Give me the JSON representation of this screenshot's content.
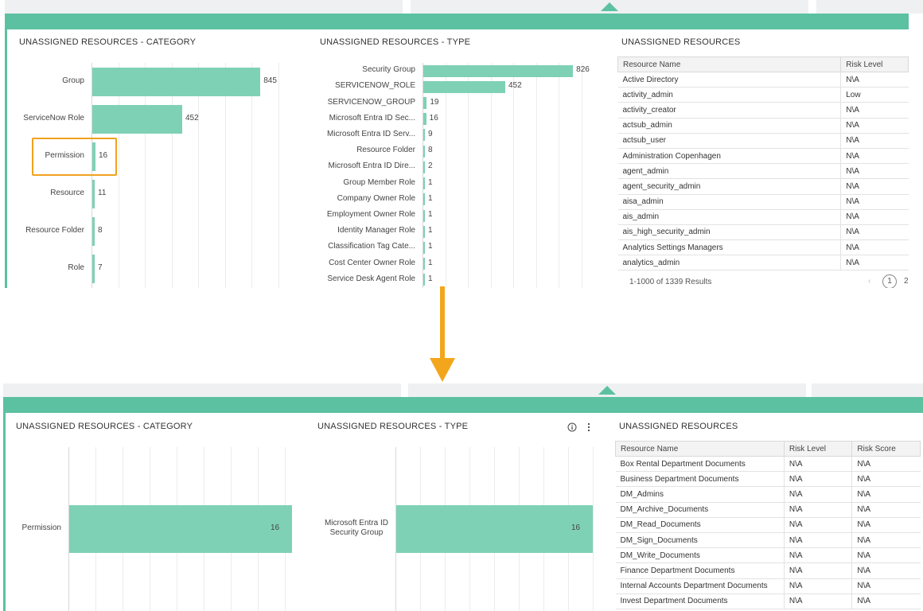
{
  "top": {
    "category_panel": {
      "title": "UNASSIGNED RESOURCES - CATEGORY",
      "chart_data": {
        "type": "bar",
        "orientation": "horizontal",
        "categories": [
          "Group",
          "ServiceNow Role",
          "Permission",
          "Resource",
          "Resource Folder",
          "Role"
        ],
        "values": [
          845,
          452,
          16,
          11,
          8,
          7
        ],
        "highlighted_category": "Permission"
      }
    },
    "type_panel": {
      "title": "UNASSIGNED RESOURCES - TYPE",
      "chart_data": {
        "type": "bar",
        "orientation": "horizontal",
        "categories": [
          "Security Group",
          "SERVICENOW_ROLE",
          "SERVICENOW_GROUP",
          "Microsoft Entra ID Sec...",
          "Microsoft Entra ID Serv...",
          "Resource Folder",
          "Microsoft Entra ID Dire...",
          "Group Member Role",
          "Company Owner Role",
          "Employment Owner Role",
          "Identity Manager Role",
          "Classification Tag Cate...",
          "Cost Center Owner Role",
          "Service Desk Agent Role"
        ],
        "values": [
          826,
          452,
          19,
          16,
          9,
          8,
          2,
          1,
          1,
          1,
          1,
          1,
          1,
          1
        ]
      }
    },
    "resources_panel": {
      "title": "UNASSIGNED RESOURCES",
      "columns": [
        "Resource Name",
        "Risk Level"
      ],
      "rows": [
        [
          "Active Directory",
          "N\\A"
        ],
        [
          "activity_admin",
          "Low"
        ],
        [
          "activity_creator",
          "N\\A"
        ],
        [
          "actsub_admin",
          "N\\A"
        ],
        [
          "actsub_user",
          "N\\A"
        ],
        [
          "Administration Copenhagen",
          "N\\A"
        ],
        [
          "agent_admin",
          "N\\A"
        ],
        [
          "agent_security_admin",
          "N\\A"
        ],
        [
          "aisa_admin",
          "N\\A"
        ],
        [
          "ais_admin",
          "N\\A"
        ],
        [
          "ais_high_security_admin",
          "N\\A"
        ],
        [
          "Analytics Settings Managers",
          "N\\A"
        ],
        [
          "analytics_admin",
          "N\\A"
        ]
      ],
      "pager_summary": "1-1000 of 1339 Results",
      "pager_prev": "‹",
      "pager_current": "1",
      "pager_next_page": "2"
    }
  },
  "bottom": {
    "category_panel": {
      "title": "UNASSIGNED RESOURCES - CATEGORY",
      "chart_data": {
        "type": "bar",
        "orientation": "horizontal",
        "categories": [
          "Permission"
        ],
        "values": [
          16
        ]
      }
    },
    "type_panel": {
      "title": "UNASSIGNED RESOURCES - TYPE",
      "info_icon": "info-icon",
      "more_icon": "more-vertical-icon",
      "chart_data": {
        "type": "bar",
        "orientation": "horizontal",
        "categories": [
          "Microsoft Entra ID Security Group"
        ],
        "category_lines": [
          [
            "Microsoft Entra ID",
            "Security Group"
          ]
        ],
        "values": [
          16
        ]
      }
    },
    "resources_panel": {
      "title": "UNASSIGNED RESOURCES",
      "columns": [
        "Resource Name",
        "Risk Level",
        "Risk Score"
      ],
      "rows": [
        [
          "Box Rental Department Documents",
          "N\\A",
          "N\\A"
        ],
        [
          "Business Department Documents",
          "N\\A",
          "N\\A"
        ],
        [
          "DM_Admins",
          "N\\A",
          "N\\A"
        ],
        [
          "DM_Archive_Documents",
          "N\\A",
          "N\\A"
        ],
        [
          "DM_Read_Documents",
          "N\\A",
          "N\\A"
        ],
        [
          "DM_Sign_Documents",
          "N\\A",
          "N\\A"
        ],
        [
          "DM_Write_Documents",
          "N\\A",
          "N\\A"
        ],
        [
          "Finance Department Documents",
          "N\\A",
          "N\\A"
        ],
        [
          "Internal Accounts Department Documents",
          "N\\A",
          "N\\A"
        ],
        [
          "Invest Department Documents",
          "N\\A",
          "N\\A"
        ]
      ]
    }
  },
  "colors": {
    "accent_green": "#5cc1a0",
    "bar_green": "#7fd1b6",
    "highlight_orange": "#f0a21f",
    "arrow_orange": "#f3a61c"
  }
}
